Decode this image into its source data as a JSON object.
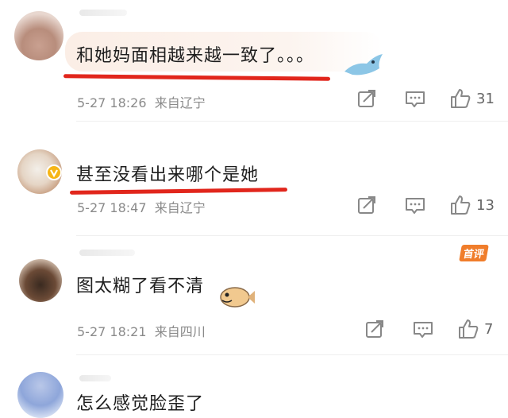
{
  "comments": [
    {
      "text": "和她妈面相越来越一致了。。。",
      "time": "5-27 18:26",
      "location": "来自辽宁",
      "likes": "31"
    },
    {
      "text": "甚至没看出来哪个是她",
      "time": "5-27 18:47",
      "location": "来自辽宁",
      "likes": "13"
    },
    {
      "text": "图太糊了看不清",
      "time": "5-27 18:21",
      "location": "来自四川",
      "likes": "7",
      "badge": "首评"
    },
    {
      "text": "怎么感觉脸歪了"
    }
  ],
  "colors": {
    "underline": "#e1261c",
    "meta_text": "#8a8a8a",
    "badge_bg": "#f07d2b",
    "bubble": "#fbeee6"
  },
  "icons": [
    "share-icon",
    "comment-icon",
    "like-icon",
    "verified-badge-icon"
  ]
}
